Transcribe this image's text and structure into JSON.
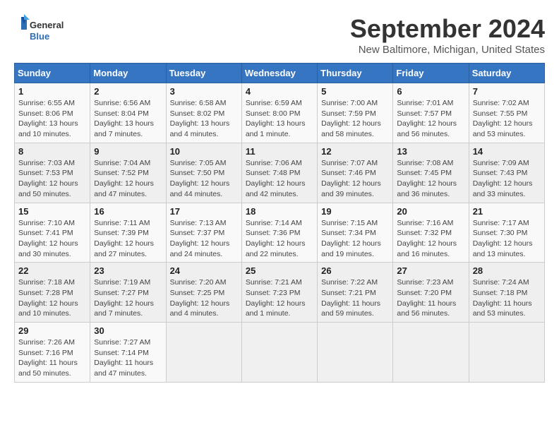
{
  "header": {
    "logo_general": "General",
    "logo_blue": "Blue",
    "month_title": "September 2024",
    "location": "New Baltimore, Michigan, United States"
  },
  "weekdays": [
    "Sunday",
    "Monday",
    "Tuesday",
    "Wednesday",
    "Thursday",
    "Friday",
    "Saturday"
  ],
  "weeks": [
    [
      {
        "day": "1",
        "info": "Sunrise: 6:55 AM\nSunset: 8:06 PM\nDaylight: 13 hours and 10 minutes."
      },
      {
        "day": "2",
        "info": "Sunrise: 6:56 AM\nSunset: 8:04 PM\nDaylight: 13 hours and 7 minutes."
      },
      {
        "day": "3",
        "info": "Sunrise: 6:58 AM\nSunset: 8:02 PM\nDaylight: 13 hours and 4 minutes."
      },
      {
        "day": "4",
        "info": "Sunrise: 6:59 AM\nSunset: 8:00 PM\nDaylight: 13 hours and 1 minute."
      },
      {
        "day": "5",
        "info": "Sunrise: 7:00 AM\nSunset: 7:59 PM\nDaylight: 12 hours and 58 minutes."
      },
      {
        "day": "6",
        "info": "Sunrise: 7:01 AM\nSunset: 7:57 PM\nDaylight: 12 hours and 56 minutes."
      },
      {
        "day": "7",
        "info": "Sunrise: 7:02 AM\nSunset: 7:55 PM\nDaylight: 12 hours and 53 minutes."
      }
    ],
    [
      {
        "day": "8",
        "info": "Sunrise: 7:03 AM\nSunset: 7:53 PM\nDaylight: 12 hours and 50 minutes."
      },
      {
        "day": "9",
        "info": "Sunrise: 7:04 AM\nSunset: 7:52 PM\nDaylight: 12 hours and 47 minutes."
      },
      {
        "day": "10",
        "info": "Sunrise: 7:05 AM\nSunset: 7:50 PM\nDaylight: 12 hours and 44 minutes."
      },
      {
        "day": "11",
        "info": "Sunrise: 7:06 AM\nSunset: 7:48 PM\nDaylight: 12 hours and 42 minutes."
      },
      {
        "day": "12",
        "info": "Sunrise: 7:07 AM\nSunset: 7:46 PM\nDaylight: 12 hours and 39 minutes."
      },
      {
        "day": "13",
        "info": "Sunrise: 7:08 AM\nSunset: 7:45 PM\nDaylight: 12 hours and 36 minutes."
      },
      {
        "day": "14",
        "info": "Sunrise: 7:09 AM\nSunset: 7:43 PM\nDaylight: 12 hours and 33 minutes."
      }
    ],
    [
      {
        "day": "15",
        "info": "Sunrise: 7:10 AM\nSunset: 7:41 PM\nDaylight: 12 hours and 30 minutes."
      },
      {
        "day": "16",
        "info": "Sunrise: 7:11 AM\nSunset: 7:39 PM\nDaylight: 12 hours and 27 minutes."
      },
      {
        "day": "17",
        "info": "Sunrise: 7:13 AM\nSunset: 7:37 PM\nDaylight: 12 hours and 24 minutes."
      },
      {
        "day": "18",
        "info": "Sunrise: 7:14 AM\nSunset: 7:36 PM\nDaylight: 12 hours and 22 minutes."
      },
      {
        "day": "19",
        "info": "Sunrise: 7:15 AM\nSunset: 7:34 PM\nDaylight: 12 hours and 19 minutes."
      },
      {
        "day": "20",
        "info": "Sunrise: 7:16 AM\nSunset: 7:32 PM\nDaylight: 12 hours and 16 minutes."
      },
      {
        "day": "21",
        "info": "Sunrise: 7:17 AM\nSunset: 7:30 PM\nDaylight: 12 hours and 13 minutes."
      }
    ],
    [
      {
        "day": "22",
        "info": "Sunrise: 7:18 AM\nSunset: 7:28 PM\nDaylight: 12 hours and 10 minutes."
      },
      {
        "day": "23",
        "info": "Sunrise: 7:19 AM\nSunset: 7:27 PM\nDaylight: 12 hours and 7 minutes."
      },
      {
        "day": "24",
        "info": "Sunrise: 7:20 AM\nSunset: 7:25 PM\nDaylight: 12 hours and 4 minutes."
      },
      {
        "day": "25",
        "info": "Sunrise: 7:21 AM\nSunset: 7:23 PM\nDaylight: 12 hours and 1 minute."
      },
      {
        "day": "26",
        "info": "Sunrise: 7:22 AM\nSunset: 7:21 PM\nDaylight: 11 hours and 59 minutes."
      },
      {
        "day": "27",
        "info": "Sunrise: 7:23 AM\nSunset: 7:20 PM\nDaylight: 11 hours and 56 minutes."
      },
      {
        "day": "28",
        "info": "Sunrise: 7:24 AM\nSunset: 7:18 PM\nDaylight: 11 hours and 53 minutes."
      }
    ],
    [
      {
        "day": "29",
        "info": "Sunrise: 7:26 AM\nSunset: 7:16 PM\nDaylight: 11 hours and 50 minutes."
      },
      {
        "day": "30",
        "info": "Sunrise: 7:27 AM\nSunset: 7:14 PM\nDaylight: 11 hours and 47 minutes."
      },
      null,
      null,
      null,
      null,
      null
    ]
  ]
}
